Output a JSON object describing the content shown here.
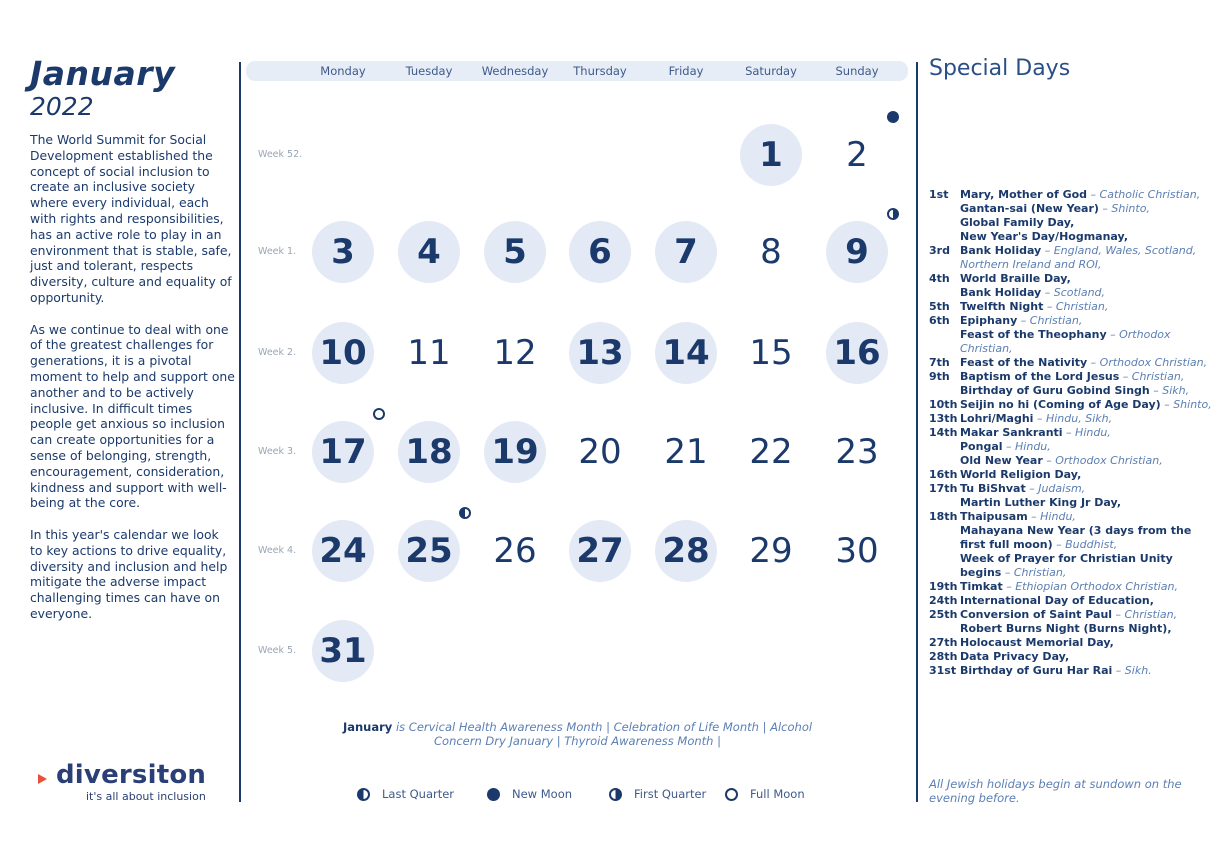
{
  "header": {
    "month": "January",
    "year": "2022"
  },
  "intro": {
    "p1": "The World Summit for Social Development established the concept of social inclusion to create an inclusive society where every individual, each with rights and responsibilities, has an active role to play in an environment that is stable, safe, just and tolerant, respects diversity, culture and equality of opportunity.",
    "p2": "As we continue to deal with one of the greatest challenges for generations, it is a pivotal moment to help and support one another and to be actively inclusive. In difficult times people get anxious so inclusion can create opportunities for a sense of belonging, strength, encouragement, consideration, kindness and support with well-being at the core.",
    "p3": "In this year's calendar we look to key actions to drive equality, diversity and inclusion and help mitigate the adverse impact challenging times can have on everyone."
  },
  "logo": {
    "word": "diversiton",
    "tagline": "it's all about inclusion"
  },
  "calendar": {
    "day_names": [
      "Monday",
      "Tuesday",
      "Wednesday",
      "Thursday",
      "Friday",
      "Saturday",
      "Sunday"
    ],
    "weeks": [
      {
        "label": "Week 52.",
        "days": [
          null,
          null,
          null,
          null,
          null,
          {
            "n": "1",
            "hl": true
          },
          {
            "n": "2",
            "hl": false
          }
        ]
      },
      {
        "label": "Week 1.",
        "days": [
          {
            "n": "3",
            "hl": true
          },
          {
            "n": "4",
            "hl": true
          },
          {
            "n": "5",
            "hl": true
          },
          {
            "n": "6",
            "hl": true
          },
          {
            "n": "7",
            "hl": true
          },
          {
            "n": "8",
            "hl": false
          },
          {
            "n": "9",
            "hl": true
          }
        ]
      },
      {
        "label": "Week 2.",
        "days": [
          {
            "n": "10",
            "hl": true
          },
          {
            "n": "11",
            "hl": false
          },
          {
            "n": "12",
            "hl": false
          },
          {
            "n": "13",
            "hl": true
          },
          {
            "n": "14",
            "hl": true
          },
          {
            "n": "15",
            "hl": false
          },
          {
            "n": "16",
            "hl": true
          }
        ]
      },
      {
        "label": "Week 3.",
        "days": [
          {
            "n": "17",
            "hl": true
          },
          {
            "n": "18",
            "hl": true
          },
          {
            "n": "19",
            "hl": true
          },
          {
            "n": "20",
            "hl": false
          },
          {
            "n": "21",
            "hl": false
          },
          {
            "n": "22",
            "hl": false
          },
          {
            "n": "23",
            "hl": false
          }
        ]
      },
      {
        "label": "Week 4.",
        "days": [
          {
            "n": "24",
            "hl": true
          },
          {
            "n": "25",
            "hl": true
          },
          {
            "n": "26",
            "hl": false
          },
          {
            "n": "27",
            "hl": true
          },
          {
            "n": "28",
            "hl": true
          },
          {
            "n": "29",
            "hl": false
          },
          {
            "n": "30",
            "hl": false
          }
        ]
      },
      {
        "label": "Week 5.",
        "days": [
          {
            "n": "31",
            "hl": true
          },
          null,
          null,
          null,
          null,
          null,
          null
        ]
      }
    ],
    "moon_phases": [
      {
        "date": "2",
        "phase": "new"
      },
      {
        "date": "9",
        "phase": "firstq"
      },
      {
        "date": "17",
        "phase": "full"
      },
      {
        "date": "25",
        "phase": "lastq"
      }
    ]
  },
  "awareness": {
    "lead": "January",
    "text": " is Cervical Health Awareness Month  |  Celebration of Life Month  |  Alcohol Concern Dry January  |  Thyroid Awareness Month  |"
  },
  "legend": [
    {
      "phase": "lastq",
      "label": "Last Quarter"
    },
    {
      "phase": "new",
      "label": "New Moon"
    },
    {
      "phase": "firstq",
      "label": "First Quarter"
    },
    {
      "phase": "full",
      "label": "Full Moon"
    }
  ],
  "special_days": {
    "title": "Special Days",
    "entries": [
      {
        "date": "1st",
        "events": [
          {
            "name": "Mary, Mother of God",
            "note": " – Catholic Christian,"
          },
          {
            "name": "Gantan-sai (New Year)",
            "note": " – Shinto,"
          },
          {
            "name": "Global Family Day,",
            "note": ""
          },
          {
            "name": "New Year's Day/Hogmanay,",
            "note": ""
          }
        ]
      },
      {
        "date": "3rd",
        "events": [
          {
            "name": "Bank Holiday",
            "note": " – England, Wales, Scotland, Northern Ireland and ROI,"
          }
        ]
      },
      {
        "date": "4th",
        "events": [
          {
            "name": "World Braille Day,",
            "note": ""
          },
          {
            "name": "Bank Holiday",
            "note": " – Scotland,"
          }
        ]
      },
      {
        "date": "5th",
        "events": [
          {
            "name": "Twelfth Night",
            "note": " – Christian,"
          }
        ]
      },
      {
        "date": "6th",
        "events": [
          {
            "name": "Epiphany",
            "note": " – Christian,"
          },
          {
            "name": "Feast of the Theophany",
            "note": " – Orthodox Christian,"
          }
        ]
      },
      {
        "date": "7th",
        "events": [
          {
            "name": "Feast of the Nativity",
            "note": " – Orthodox Christian,"
          }
        ]
      },
      {
        "date": "9th",
        "events": [
          {
            "name": "Baptism of the Lord Jesus",
            "note": " – Christian,"
          },
          {
            "name": "Birthday of Guru Gobind Singh",
            "note": " – Sikh,"
          }
        ]
      },
      {
        "date": "10th",
        "events": [
          {
            "name": "Seijin no hi (Coming of Age Day)",
            "note": " – Shinto,"
          }
        ]
      },
      {
        "date": "13th",
        "events": [
          {
            "name": "Lohri/Maghi",
            "note": " – Hindu, Sikh,"
          }
        ]
      },
      {
        "date": "14th",
        "events": [
          {
            "name": "Makar Sankranti",
            "note": " – Hindu,"
          },
          {
            "name": "Pongal",
            "note": " – Hindu,"
          },
          {
            "name": "Old New Year",
            "note": " – Orthodox Christian,"
          }
        ]
      },
      {
        "date": "16th",
        "events": [
          {
            "name": "World Religion Day,",
            "note": ""
          }
        ]
      },
      {
        "date": "17th",
        "events": [
          {
            "name": "Tu BiShvat",
            "note": " – Judaism,"
          },
          {
            "name": "Martin Luther King Jr Day,",
            "note": ""
          }
        ]
      },
      {
        "date": "18th",
        "events": [
          {
            "name": "Thaipusam",
            "note": " – Hindu,"
          },
          {
            "name": "Mahayana New Year (3 days from the first full moon)",
            "note": " – Buddhist,"
          },
          {
            "name": "Week of Prayer for Christian Unity begins",
            "note": " – Christian,"
          }
        ]
      },
      {
        "date": "19th",
        "events": [
          {
            "name": "Timkat",
            "note": " – Ethiopian Orthodox Christian,"
          }
        ]
      },
      {
        "date": "24th",
        "events": [
          {
            "name": "International Day of Education,",
            "note": ""
          }
        ]
      },
      {
        "date": "25th",
        "events": [
          {
            "name": "Conversion of Saint Paul",
            "note": " – Christian,"
          },
          {
            "name": "Robert Burns Night (Burns Night),",
            "note": ""
          }
        ]
      },
      {
        "date": "27th",
        "events": [
          {
            "name": "Holocaust Memorial Day,",
            "note": ""
          }
        ]
      },
      {
        "date": "28th",
        "events": [
          {
            "name": "Data Privacy Day,",
            "note": ""
          }
        ]
      },
      {
        "date": "31st",
        "events": [
          {
            "name": "Birthday of Guru Har Rai",
            "note": " – Sikh."
          }
        ]
      }
    ],
    "footnote": "All Jewish holidays begin at sundown on the evening before."
  },
  "colors": {
    "navy": "#1b3a6b",
    "highlight_circle": "#e3eaf5",
    "header_band": "#e6edf6",
    "accent_note": "#5b7fb3",
    "logo_arrow": "#e7503a"
  }
}
